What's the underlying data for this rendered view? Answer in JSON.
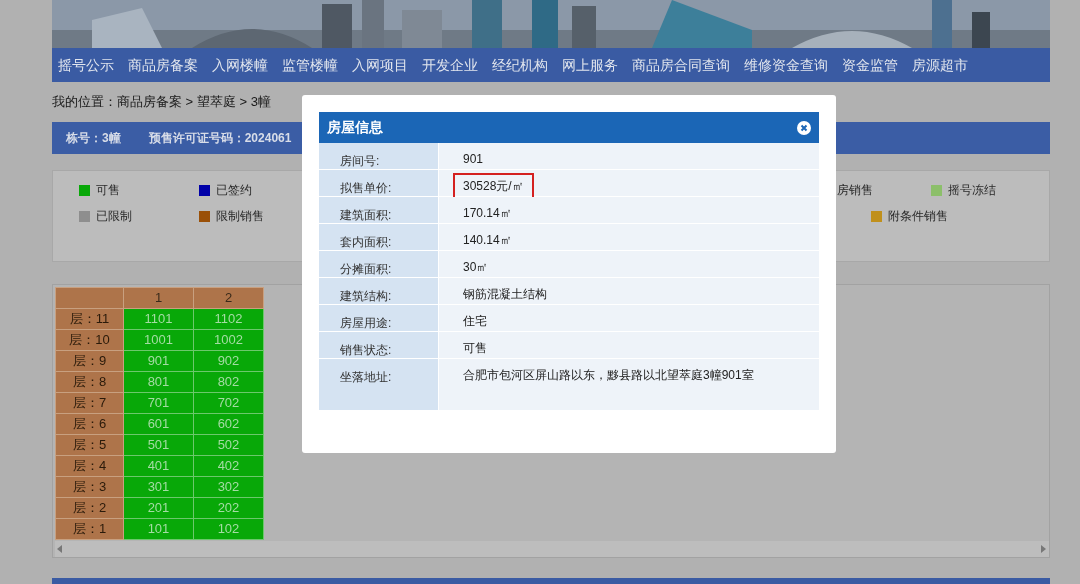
{
  "nav": {
    "items": [
      "摇号公示",
      "商品房备案",
      "入网楼幢",
      "监管楼幢",
      "入网项目",
      "开发企业",
      "经纪机构",
      "网上服务",
      "商品房合同查询",
      "维修资金查询",
      "资金监管",
      "房源超市"
    ]
  },
  "breadcrumb": "我的位置：商品房备案 > 望萃庭 > 3幢",
  "building_bar": {
    "building": "栋号：3幢",
    "permit": "预售许可证号码：2024061"
  },
  "legend": {
    "row_1": [
      {
        "label": "可售",
        "color": "#08a808"
      },
      {
        "label": "已签约",
        "color": "#0000a8"
      },
      {
        "label": "房销售"
      },
      {
        "label": "摇号冻结",
        "color": "#8cbf6a"
      }
    ],
    "row_2": [
      {
        "label": "已限制",
        "color": "#8e8e8e"
      },
      {
        "label": "限制销售",
        "color": "#9a5008"
      },
      {
        "label": "附条件销售",
        "color": "#c0901c"
      }
    ]
  },
  "units_table": {
    "columns": [
      "1",
      "2"
    ],
    "rows": [
      {
        "floor": "层：11",
        "units": [
          "1101",
          "1102"
        ]
      },
      {
        "floor": "层：10",
        "units": [
          "1001",
          "1002"
        ]
      },
      {
        "floor": "层：9",
        "units": [
          "901",
          "902"
        ]
      },
      {
        "floor": "层：8",
        "units": [
          "801",
          "802"
        ]
      },
      {
        "floor": "层：7",
        "units": [
          "701",
          "702"
        ]
      },
      {
        "floor": "层：6",
        "units": [
          "601",
          "602"
        ]
      },
      {
        "floor": "层：5",
        "units": [
          "501",
          "502"
        ]
      },
      {
        "floor": "层：4",
        "units": [
          "401",
          "402"
        ]
      },
      {
        "floor": "层：3",
        "units": [
          "301",
          "302"
        ]
      },
      {
        "floor": "层：2",
        "units": [
          "201",
          "202"
        ]
      },
      {
        "floor": "层：1",
        "units": [
          "101",
          "102"
        ]
      }
    ]
  },
  "dialog": {
    "title": "房屋信息",
    "fields": [
      {
        "label": "房间号:",
        "value": "901",
        "highlighted": false
      },
      {
        "label": "拟售单价:",
        "value": "30528元/㎡",
        "highlighted": true
      },
      {
        "label": "建筑面积:",
        "value": "170.14㎡",
        "highlighted": false
      },
      {
        "label": "套内面积:",
        "value": "140.14㎡",
        "highlighted": false
      },
      {
        "label": "分摊面积:",
        "value": "30㎡",
        "highlighted": false
      },
      {
        "label": "建筑结构:",
        "value": "钢筋混凝土结构",
        "highlighted": false
      },
      {
        "label": "房屋用途:",
        "value": "住宅",
        "highlighted": false
      },
      {
        "label": "销售状态:",
        "value": "可售",
        "highlighted": false
      },
      {
        "label": "坐落地址:",
        "value": "合肥市包河区屏山路以东，黟县路以北望萃庭3幢901室",
        "highlighted": false
      }
    ]
  }
}
